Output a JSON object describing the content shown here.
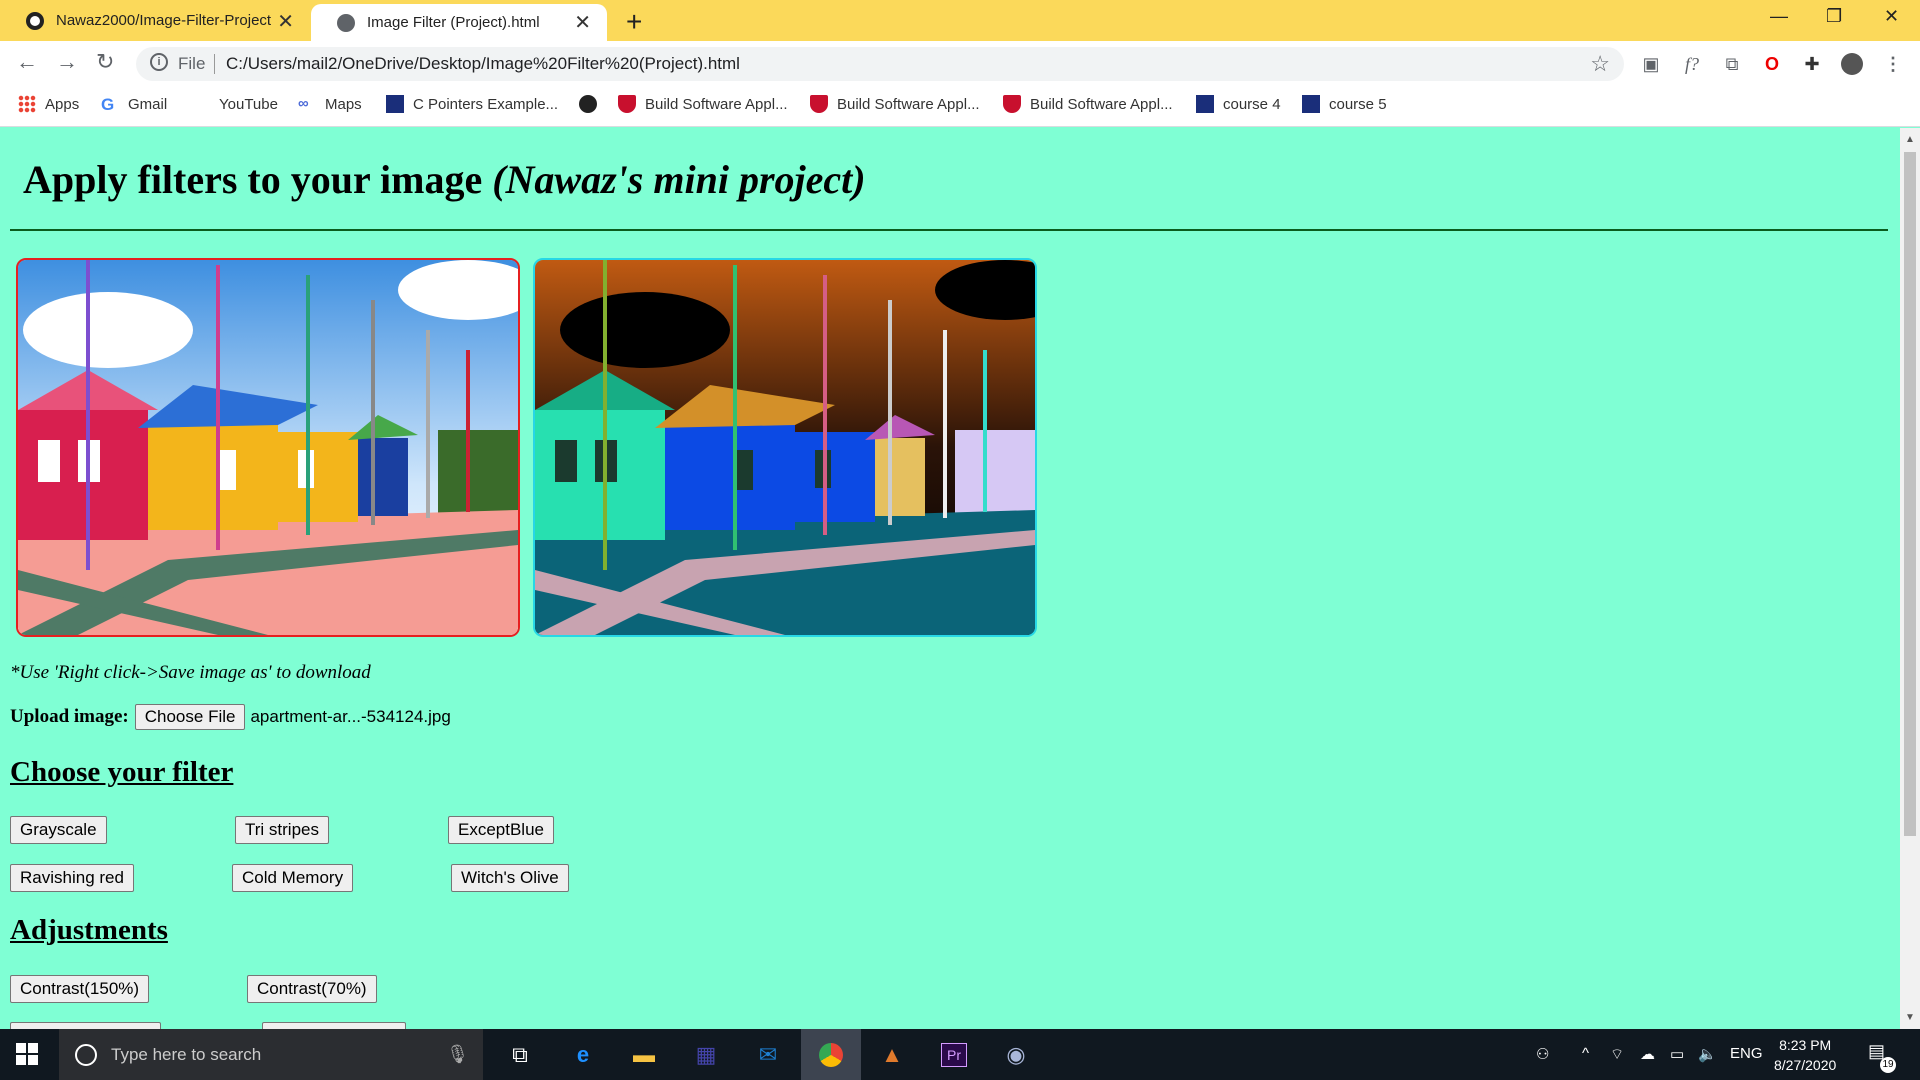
{
  "browser": {
    "tabs": [
      {
        "title": "Nawaz2000/Image-Filter-Project"
      },
      {
        "title": "Image Filter (Project).html"
      }
    ],
    "omnibox": {
      "scheme_label": "File",
      "url": "C:/Users/mail2/OneDrive/Desktop/Image%20Filter%20(Project).html"
    },
    "bookmarks": [
      {
        "label": "Apps"
      },
      {
        "label": "Gmail"
      },
      {
        "label": "YouTube"
      },
      {
        "label": "Maps"
      },
      {
        "label": "C Pointers Example..."
      },
      {
        "label": "Build Software Appl..."
      },
      {
        "label": "Build Software Appl..."
      },
      {
        "label": "Build Software Appl..."
      },
      {
        "label": "course 4"
      },
      {
        "label": "course 5"
      }
    ]
  },
  "page": {
    "title_main": "Apply filters to your image ",
    "title_italic": "(Nawaz's mini project)",
    "save_note": "*Use 'Right click->Save image as' to download",
    "upload": {
      "label": "Upload image:",
      "button": "Choose File",
      "file_name": "apartment-ar...-534124.jpg"
    },
    "filters_heading": "Choose your filter",
    "filters": [
      "Grayscale",
      "Tri stripes",
      "ExceptBlue",
      "Ravishing red",
      "Cold Memory",
      "Witch's Olive"
    ],
    "adjustments_heading": "Adjustments",
    "adjustments": [
      "Contrast(150%)",
      "Contrast(70%)"
    ]
  },
  "taskbar": {
    "search_placeholder": "Type here to search",
    "language": "ENG",
    "time": "8:23 PM",
    "date": "8/27/2020",
    "notification_count": "19"
  },
  "colors": {
    "page_background": "#7fffd4",
    "tab_strip": "#fbd95a",
    "original_border": "#e62020",
    "filtered_border": "#27d7e6"
  }
}
